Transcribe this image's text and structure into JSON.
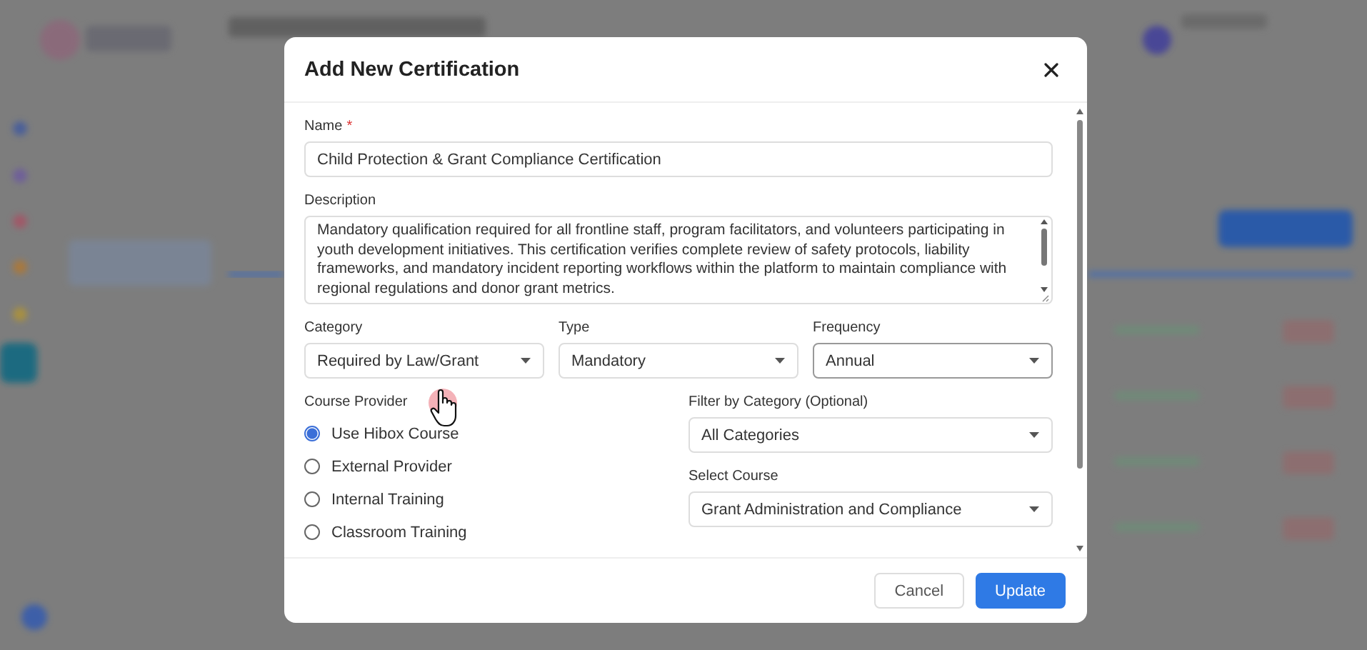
{
  "dialog": {
    "title": "Add New Certification",
    "name": {
      "label": "Name",
      "required_mark": "*",
      "value": "Child Protection & Grant Compliance Certification"
    },
    "description": {
      "label": "Description",
      "value": "Mandatory qualification required for all frontline staff, program facilitators, and volunteers participating in youth development initiatives. This certification verifies complete review of safety protocols, liability frameworks, and mandatory incident reporting workflows within the platform to maintain compliance with regional regulations and donor grant metrics."
    },
    "selects": [
      {
        "label": "Category",
        "value": "Required by Law/Grant",
        "focused": false
      },
      {
        "label": "Type",
        "value": "Mandatory",
        "focused": false
      },
      {
        "label": "Frequency",
        "value": "Annual",
        "focused": true
      }
    ],
    "course_provider": {
      "label": "Course Provider",
      "options": [
        {
          "label": "Use Hibox Course",
          "selected": true
        },
        {
          "label": "External Provider",
          "selected": false
        },
        {
          "label": "Internal Training",
          "selected": false
        },
        {
          "label": "Classroom Training",
          "selected": false
        }
      ]
    },
    "filter": {
      "label": "Filter by Category (Optional)",
      "value": "All Categories"
    },
    "course": {
      "label": "Select Course",
      "value": "Grant Administration and Compliance"
    },
    "buttons": [
      {
        "kind": "secondary",
        "label": "Cancel"
      },
      {
        "kind": "primary",
        "label": "Update"
      }
    ]
  }
}
